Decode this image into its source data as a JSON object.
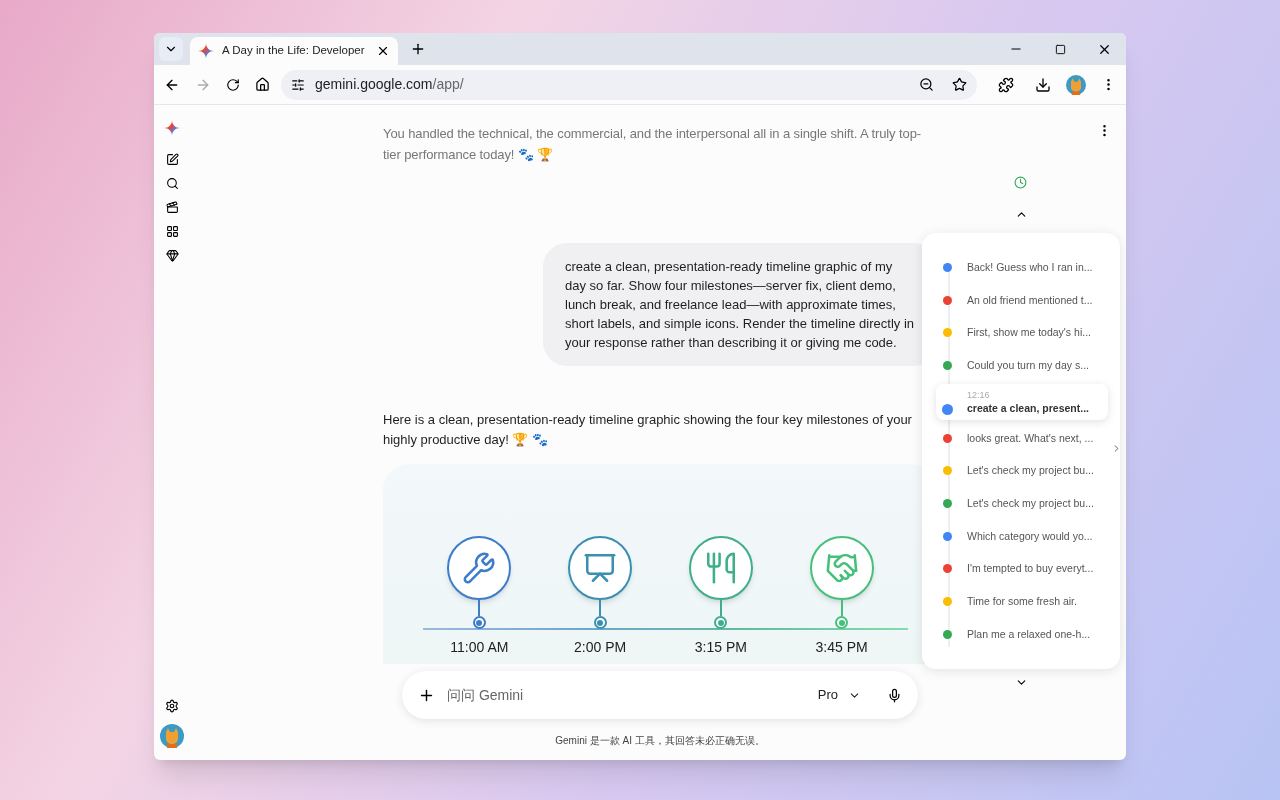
{
  "tab": {
    "title": "A Day in the Life: Developer",
    "selected": true
  },
  "address": {
    "host": "gemini.google.com",
    "path": "/app/"
  },
  "conversation": {
    "previous_reply": "You handled the technical, the commercial, and the interpersonal all in a single shift. A truly top-tier performance today! 🐾 🏆",
    "user_message": "create a clean, presentation-ready timeline graphic of my day so far. Show four milestones—server fix, client demo, lunch break, and freelance lead—with approximate times, short labels, and simple icons. Render the timeline directly in your response rather than describing it or giving me code.",
    "reply_intro": "Here is a clean, presentation-ready timeline graphic showing the four key milestones of your highly productive day! 🏆 🐾",
    "milestones": [
      {
        "kind": "server",
        "time": "11:00 AM",
        "color": "#3d7cc9"
      },
      {
        "kind": "demo",
        "time": "2:00 PM",
        "color": "#3b8fb0"
      },
      {
        "kind": "lunch",
        "time": "3:15 PM",
        "color": "#3fae8a"
      },
      {
        "kind": "lead",
        "time": "3:45 PM",
        "color": "#45c07a"
      }
    ]
  },
  "input": {
    "placeholder": "问问 Gemini",
    "model": "Pro"
  },
  "disclaimer": "Gemini 是一款 AI 工具，其回答未必正确无误。",
  "outline": [
    {
      "text": "Back! Guess who I ran in...",
      "color": "#4285f4",
      "selected": false
    },
    {
      "text": "An old friend mentioned t...",
      "color": "#ea4335",
      "selected": false
    },
    {
      "text": "First, show me today's hi...",
      "color": "#fbbc04",
      "selected": false
    },
    {
      "text": "Could you turn my day s...",
      "color": "#34a853",
      "selected": false
    },
    {
      "text": "create a clean, present...",
      "time": "12:16",
      "color": "#4285f4",
      "selected": true
    },
    {
      "text": "looks great. What's next, ...",
      "color": "#ea4335",
      "selected": false
    },
    {
      "text": "Let's check my project bu...",
      "color": "#fbbc04",
      "selected": false
    },
    {
      "text": "Let's check my project bu...",
      "color": "#34a853",
      "selected": false
    },
    {
      "text": "Which category would yo...",
      "color": "#4285f4",
      "selected": false
    },
    {
      "text": "I'm tempted to buy everyt...",
      "color": "#ea4335",
      "selected": false
    },
    {
      "text": "Time for some fresh air.",
      "color": "#fbbc04",
      "selected": false
    },
    {
      "text": "Plan me a relaxed one-h...",
      "color": "#34a853",
      "selected": false
    }
  ]
}
